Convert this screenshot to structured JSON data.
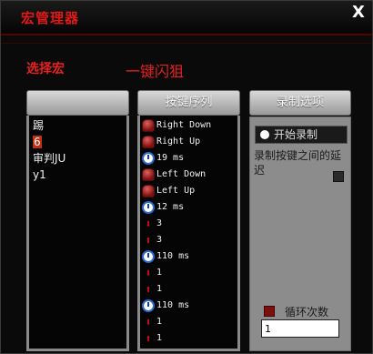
{
  "window": {
    "title": "宏管理器",
    "close_label": "X"
  },
  "select_label": "选择宏",
  "macro_name": "一键闪狙",
  "macro_list": {
    "header": "",
    "items": [
      {
        "label": "踢",
        "selected": false
      },
      {
        "label": "6",
        "selected": true
      },
      {
        "label": "审判JU",
        "selected": false
      },
      {
        "label": "y1",
        "selected": false
      }
    ]
  },
  "sequence": {
    "header": "按键序列",
    "items": [
      {
        "icon": "mouse-icon",
        "text": "Right Down"
      },
      {
        "icon": "mouse-icon",
        "text": "Right Up"
      },
      {
        "icon": "clock-icon",
        "text": "19 ms"
      },
      {
        "icon": "mouse-icon",
        "text": "Left Down"
      },
      {
        "icon": "mouse-icon",
        "text": "Left Up"
      },
      {
        "icon": "clock-icon",
        "text": "12 ms"
      },
      {
        "icon": "arrow-down-icon",
        "text": "3"
      },
      {
        "icon": "arrow-up-icon",
        "text": "3"
      },
      {
        "icon": "clock-icon",
        "text": "110 ms"
      },
      {
        "icon": "arrow-down-icon",
        "text": "1"
      },
      {
        "icon": "arrow-up-icon",
        "text": "1"
      },
      {
        "icon": "clock-icon",
        "text": "110 ms"
      },
      {
        "icon": "arrow-down-icon",
        "text": "1"
      },
      {
        "icon": "arrow-up-icon",
        "text": "1"
      }
    ]
  },
  "options": {
    "header": "录制选项",
    "record_button": "开始录制",
    "record_gap_label": "录制按键之间的延迟",
    "loop_label": "循环次数",
    "loop_value": "1"
  },
  "colors": {
    "accent": "#e01818",
    "panel": "#8c8c8c",
    "background": "#0a0a0a"
  }
}
